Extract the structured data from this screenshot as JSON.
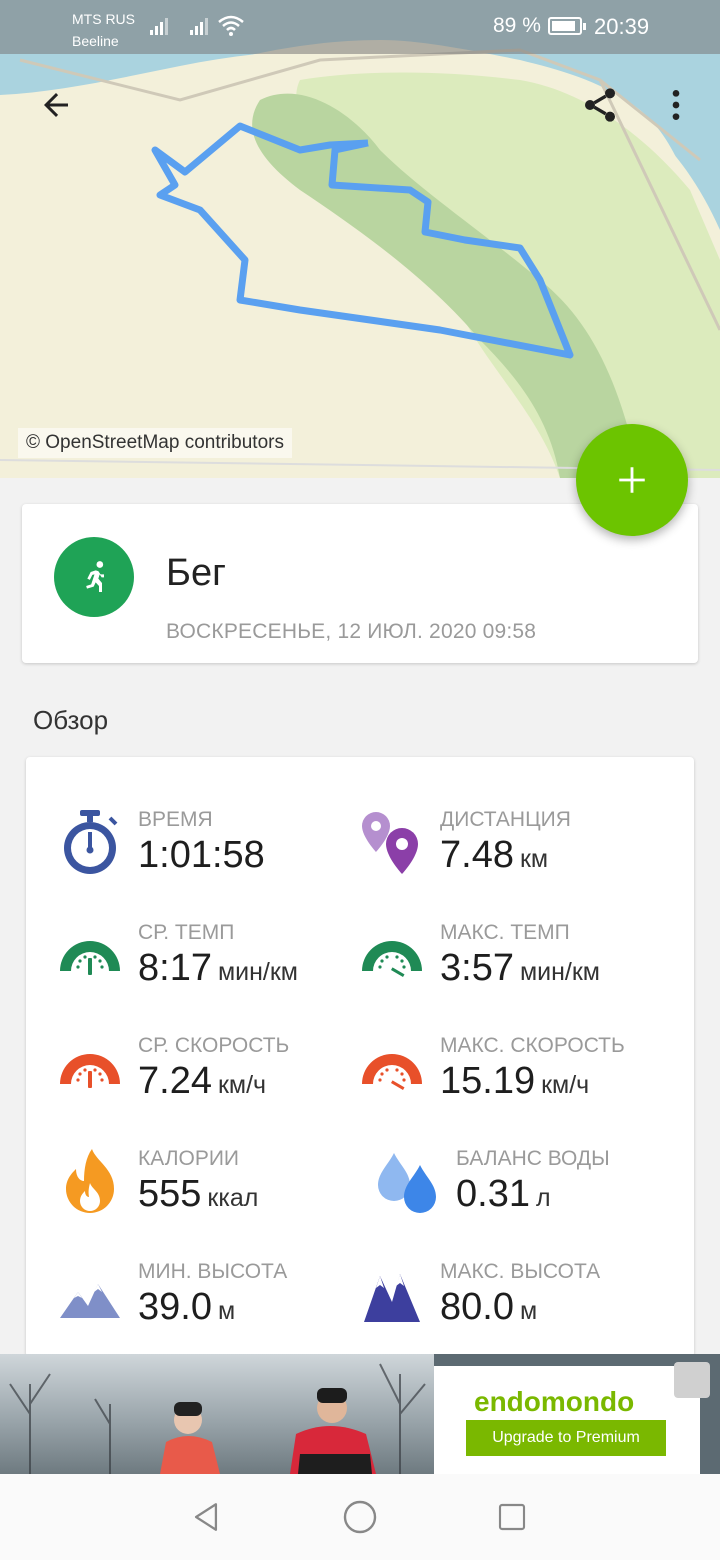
{
  "status_bar": {
    "carrier1": "MTS RUS",
    "carrier2": "Beeline",
    "battery_text": "89 %",
    "battery_level": 0.89,
    "time": "20:39"
  },
  "toolbar": {
    "back_icon": "arrow-left-icon",
    "share_icon": "share-icon",
    "more_icon": "more-vert-icon"
  },
  "map": {
    "credit": "© OpenStreetMap contributors",
    "route_color": "#5aa0f0"
  },
  "fab": {
    "icon": "plus-icon",
    "color": "#6cc400"
  },
  "workout": {
    "sport_icon": "running-icon",
    "sport_color": "#1fa356",
    "sport": "Бег",
    "date": "ВОСКРЕСЕНЬЕ, 12 ИЮЛ. 2020 09:58"
  },
  "overview": {
    "title": "Обзор",
    "stats": [
      {
        "id": "time",
        "label": "ВРЕМЯ",
        "value": "1:01:58",
        "unit": "",
        "icon": "stopwatch-icon"
      },
      {
        "id": "distance",
        "label": "ДИСТАНЦИЯ",
        "value": "7.48",
        "unit": "км",
        "icon": "map-pins-icon"
      },
      {
        "id": "avg_pace",
        "label": "СР. ТЕМП",
        "value": "8:17",
        "unit": "мин/км",
        "icon": "pace-gauge-icon"
      },
      {
        "id": "max_pace",
        "label": "МАКС. ТЕМП",
        "value": "3:57",
        "unit": "мин/км",
        "icon": "pace-gauge-icon"
      },
      {
        "id": "avg_speed",
        "label": "СР. СКОРОСТЬ",
        "value": "7.24",
        "unit": "км/ч",
        "icon": "speed-gauge-icon"
      },
      {
        "id": "max_speed",
        "label": "МАКС. СКОРОСТЬ",
        "value": "15.19",
        "unit": "км/ч",
        "icon": "speed-gauge-icon"
      },
      {
        "id": "calories",
        "label": "КАЛОРИИ",
        "value": "555",
        "unit": "ккал",
        "icon": "flame-icon"
      },
      {
        "id": "water",
        "label": "БАЛАНС ВОДЫ",
        "value": "0.31",
        "unit": "л",
        "icon": "water-drops-icon"
      },
      {
        "id": "min_alt",
        "label": "МИН. ВЫСОТА",
        "value": "39.0",
        "unit": "м",
        "icon": "mountains-icon"
      },
      {
        "id": "max_alt",
        "label": "МАКС. ВЫСОТА",
        "value": "80.0",
        "unit": "м",
        "icon": "mountains-icon"
      }
    ]
  },
  "ad": {
    "brand": "endomondo",
    "button": "Upgrade to Premium"
  },
  "nav": {
    "back": "nav-back-icon",
    "home": "nav-home-icon",
    "recents": "nav-recents-icon"
  }
}
